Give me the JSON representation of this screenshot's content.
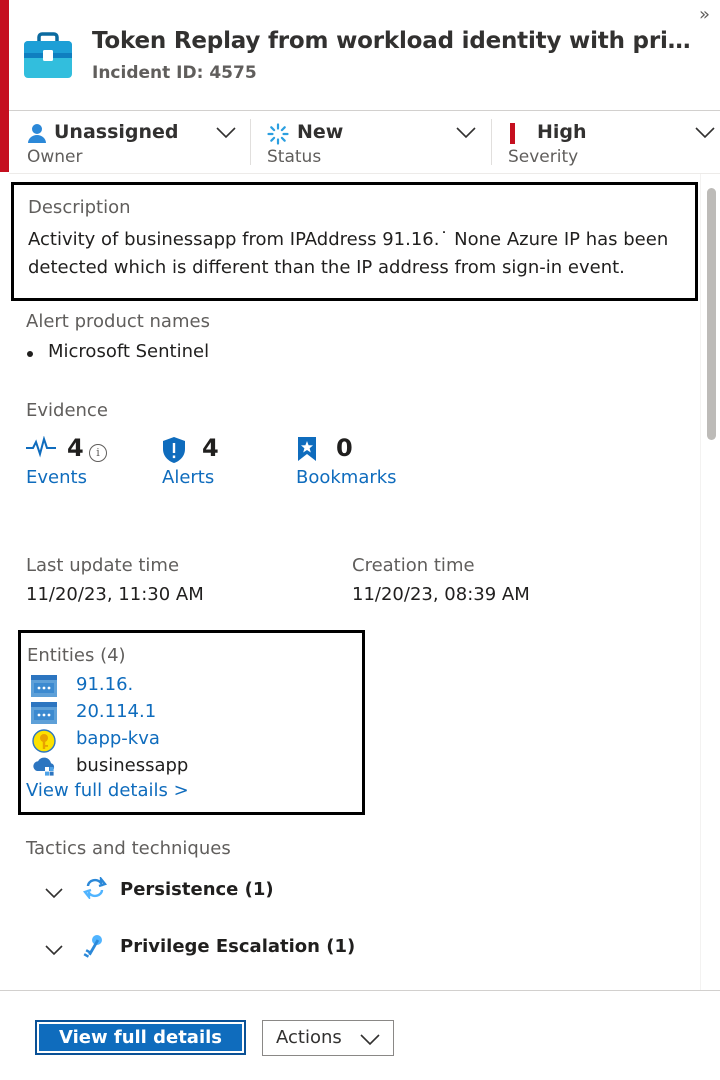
{
  "panel": {
    "collapse_glyph": "»",
    "severity_color": "#c50f1f"
  },
  "header": {
    "title": "Token Replay from workload identity with privileges ...",
    "incident_id": "Incident ID: 4575",
    "icon": "briefcase-icon"
  },
  "fields": {
    "owner": {
      "value": "Unassigned",
      "label": "Owner",
      "icon": "person-icon"
    },
    "status": {
      "value": "New",
      "label": "Status",
      "icon": "spinner-icon"
    },
    "severity": {
      "value": "High",
      "label": "Severity",
      "icon": "severity-bar-icon"
    }
  },
  "description": {
    "label": "Description",
    "text": "Activity of businessapp from IPAddress 91.16.˙            None Azure IP has been detected which is different than the IP address from sign-in event."
  },
  "alert_products": {
    "label": "Alert product names",
    "items": [
      "Microsoft Sentinel"
    ]
  },
  "evidence": {
    "label": "Evidence",
    "events": {
      "count": "4",
      "label": "Events",
      "info": "i"
    },
    "alerts": {
      "count": "4",
      "label": "Alerts"
    },
    "bookmarks": {
      "count": "0",
      "label": "Bookmarks"
    }
  },
  "times": {
    "last_update_label": "Last update time",
    "last_update_value": "11/20/23, 11:30 AM",
    "creation_label": "Creation time",
    "creation_value": "11/20/23, 08:39 AM"
  },
  "entities": {
    "label": "Entities (4)",
    "items": [
      {
        "text": "91.16.",
        "icon": "ip-address-icon",
        "link": true
      },
      {
        "text": "20.114.1",
        "icon": "ip-address-icon",
        "link": true
      },
      {
        "text": "bapp-kva",
        "icon": "key-vault-icon",
        "link": true
      },
      {
        "text": "businessapp",
        "icon": "cloud-app-icon",
        "link": false
      }
    ],
    "more_label": "View full details >"
  },
  "tactics": {
    "label": "Tactics and techniques",
    "items": [
      {
        "text": "Persistence (1)",
        "icon": "persistence-icon"
      },
      {
        "text": "Privilege Escalation (1)",
        "icon": "privilege-escalation-icon"
      }
    ]
  },
  "footer": {
    "primary_label": "View full details",
    "actions_label": "Actions"
  },
  "colors": {
    "accent": "#0f6cbd",
    "severity_high": "#c50f1f"
  }
}
